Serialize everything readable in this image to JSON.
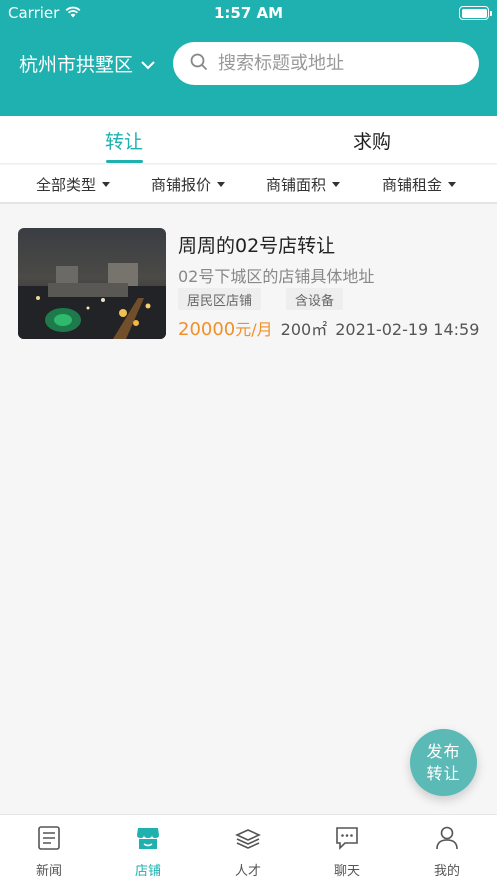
{
  "status_bar": {
    "carrier": "Carrier",
    "time": "1:57 AM"
  },
  "header": {
    "city": "杭州市拱墅区",
    "search_placeholder": "搜索标题或地址",
    "search_value": ""
  },
  "tabs": [
    {
      "label": "转让",
      "active": true
    },
    {
      "label": "求购",
      "active": false
    }
  ],
  "filters": [
    {
      "label": "全部类型"
    },
    {
      "label": "商铺报价"
    },
    {
      "label": "商铺面积"
    },
    {
      "label": "商铺租金"
    }
  ],
  "listings": [
    {
      "title": "周周的02号店转让",
      "address": "02号下城区的店铺具体地址",
      "tags": [
        "居民区店铺",
        "含设备"
      ],
      "price": "20000",
      "price_unit": "元/月",
      "area": "200㎡",
      "datetime": "2021-02-19 14:59"
    }
  ],
  "fab": {
    "line1": "发布",
    "line2": "转让"
  },
  "tabbar": [
    {
      "label": "新闻",
      "icon": "news-icon",
      "active": false
    },
    {
      "label": "店铺",
      "icon": "store-icon",
      "active": true
    },
    {
      "label": "人才",
      "icon": "talent-icon",
      "active": false
    },
    {
      "label": "聊天",
      "icon": "chat-icon",
      "active": false
    },
    {
      "label": "我的",
      "icon": "profile-icon",
      "active": false
    }
  ],
  "colors": {
    "accent": "#1fb1af",
    "price": "#f0902a",
    "fab": "#5bb9b6"
  }
}
